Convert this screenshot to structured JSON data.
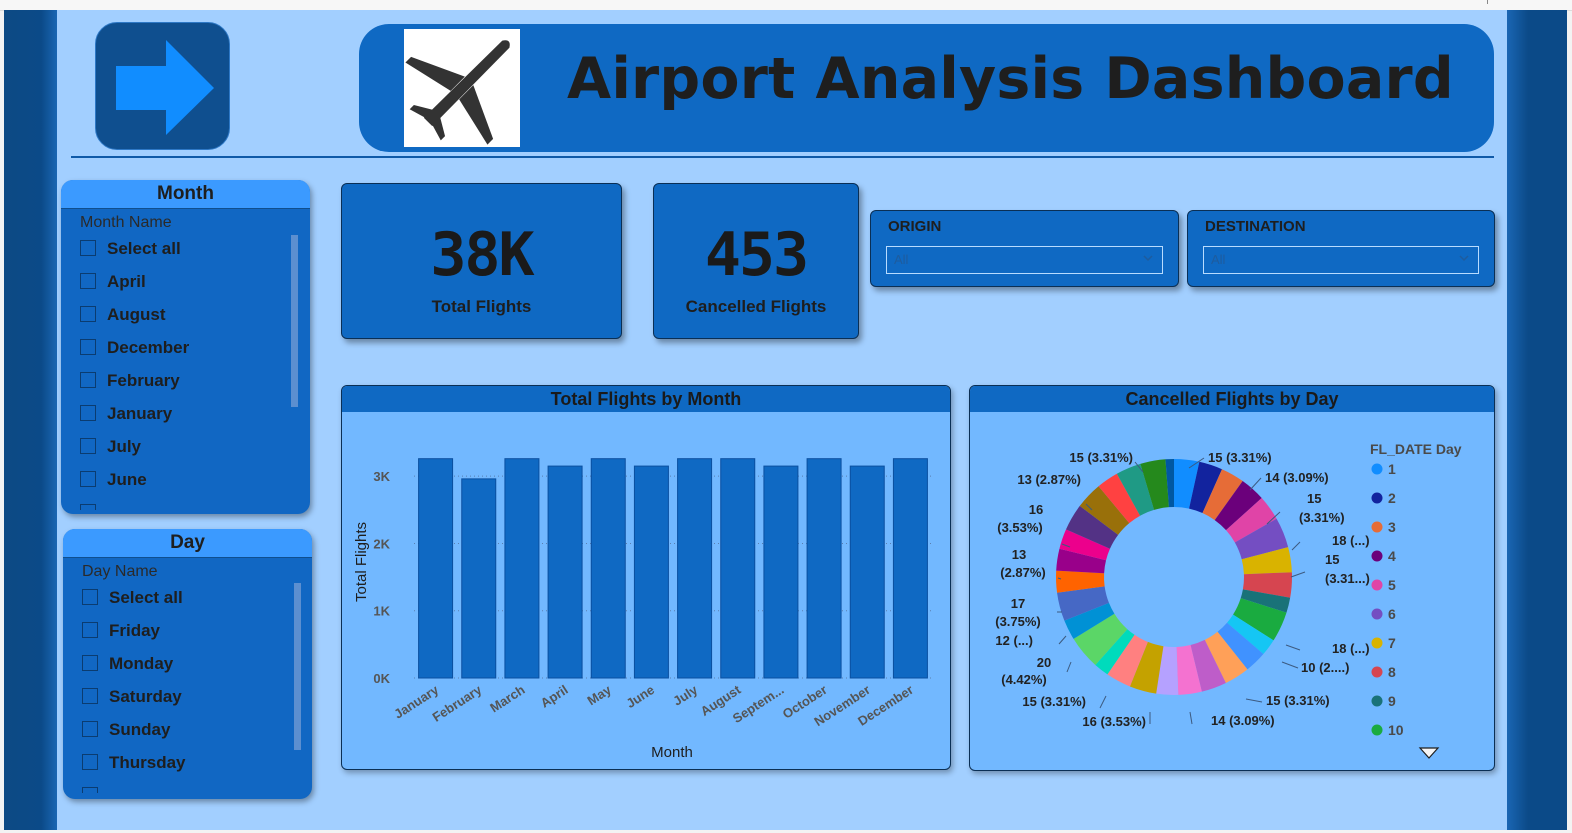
{
  "header": {
    "title": "Airport Analysis Dashboard"
  },
  "icons": {
    "nav": "arrow-right-icon",
    "logo": "airplane-icon",
    "dropdown": "chevron-down-icon",
    "legend_more": "triangle-down-icon"
  },
  "colors": {
    "frame": "#0b4a88",
    "canvas": "#a2cfff",
    "card": "#0f69c3",
    "slicer_header": "#3b9aff",
    "chart_bg": "#72b8ff",
    "bar": "#0f69c3"
  },
  "month_slicer": {
    "title": "Month",
    "subtitle": "Month Name",
    "items": [
      "Select all",
      "April",
      "August",
      "December",
      "February",
      "January",
      "July",
      "June"
    ]
  },
  "day_slicer": {
    "title": "Day",
    "subtitle": "Day Name",
    "items": [
      "Select all",
      "Friday",
      "Monday",
      "Saturday",
      "Sunday",
      "Thursday"
    ]
  },
  "kpis": [
    {
      "value": "38K",
      "label": "Total Flights"
    },
    {
      "value": "453",
      "label": "Cancelled Flights"
    }
  ],
  "filters": {
    "origin": {
      "label": "ORIGIN",
      "value": "All"
    },
    "destination": {
      "label": "DESTINATION",
      "value": "All"
    }
  },
  "chart_data": [
    {
      "type": "bar",
      "title": "Total Flights by Month",
      "xlabel": "Month",
      "ylabel": "Total Flights",
      "categories": [
        "January",
        "February",
        "March",
        "April",
        "May",
        "June",
        "July",
        "August",
        "Septem...",
        "October",
        "November",
        "December"
      ],
      "values": [
        3260,
        2960,
        3260,
        3150,
        3260,
        3150,
        3260,
        3260,
        3150,
        3260,
        3150,
        3260
      ],
      "yticks": [
        "0K",
        "1K",
        "2K",
        "3K"
      ],
      "ylim": [
        0,
        3300
      ],
      "grid": true
    },
    {
      "type": "pie",
      "title": "Cancelled Flights by Day",
      "legend_title": "FL_DATE Day",
      "legend_position": "right",
      "legend": [
        "1",
        "2",
        "3",
        "4",
        "5",
        "6",
        "7",
        "8",
        "9",
        "10"
      ],
      "slices": [
        {
          "value": 15,
          "color": "#118dff"
        },
        {
          "value": 14,
          "color": "#12239e"
        },
        {
          "value": 14,
          "color": "#e66c37"
        },
        {
          "value": 15,
          "color": "#6b007b"
        },
        {
          "value": 15,
          "color": "#e044a7"
        },
        {
          "value": 18,
          "color": "#744ec2"
        },
        {
          "value": 15,
          "color": "#d9b300"
        },
        {
          "value": 15,
          "color": "#d64550"
        },
        {
          "value": 9,
          "color": "#197278"
        },
        {
          "value": 18,
          "color": "#1aab40"
        },
        {
          "value": 10,
          "color": "#15c6f4"
        },
        {
          "value": 13,
          "color": "#4092ff"
        },
        {
          "value": 15,
          "color": "#ffa058"
        },
        {
          "value": 15,
          "color": "#be5dc9"
        },
        {
          "value": 14,
          "color": "#f472d0"
        },
        {
          "value": 13,
          "color": "#b5a1ff"
        },
        {
          "value": 16,
          "color": "#c4a200"
        },
        {
          "value": 15,
          "color": "#ff8080"
        },
        {
          "value": 9,
          "color": "#00dbbc"
        },
        {
          "value": 20,
          "color": "#5bd667"
        },
        {
          "value": 12,
          "color": "#0091d5"
        },
        {
          "value": 17,
          "color": "#4668c5"
        },
        {
          "value": 13,
          "color": "#ff6300"
        },
        {
          "value": 13,
          "color": "#99008a"
        },
        {
          "value": 12,
          "color": "#ec008c"
        },
        {
          "value": 16,
          "color": "#533285"
        },
        {
          "value": 16,
          "color": "#99700a"
        },
        {
          "value": 13,
          "color": "#ff4141"
        },
        {
          "value": 15,
          "color": "#1f9a85"
        },
        {
          "value": 15,
          "color": "#25891c"
        },
        {
          "value": 5,
          "color": "#0057a2"
        }
      ],
      "data_labels": [
        {
          "text": "15 (3.31%)"
        },
        {
          "text": "14 (3.09%)"
        },
        {
          "text": "15"
        },
        {
          "text": "(3.31%)"
        },
        {
          "text": "18 (...)"
        },
        {
          "text": "15"
        },
        {
          "text": "(3.31...)"
        },
        {
          "text": "18 (...)"
        },
        {
          "text": "10 (2....)"
        },
        {
          "text": "15 (3.31%)"
        },
        {
          "text": "14 (3.09%)"
        },
        {
          "text": "16 (3.53%)"
        },
        {
          "text": "15 (3.31%)"
        },
        {
          "text": "20"
        },
        {
          "text": "(4.42%)"
        },
        {
          "text": "12 (...)"
        },
        {
          "text": "17"
        },
        {
          "text": "(3.75%)"
        },
        {
          "text": "13"
        },
        {
          "text": "(2.87%)"
        },
        {
          "text": "16"
        },
        {
          "text": "(3.53%)"
        },
        {
          "text": "13 (2.87%)"
        },
        {
          "text": "15 (3.31%)"
        }
      ]
    }
  ]
}
